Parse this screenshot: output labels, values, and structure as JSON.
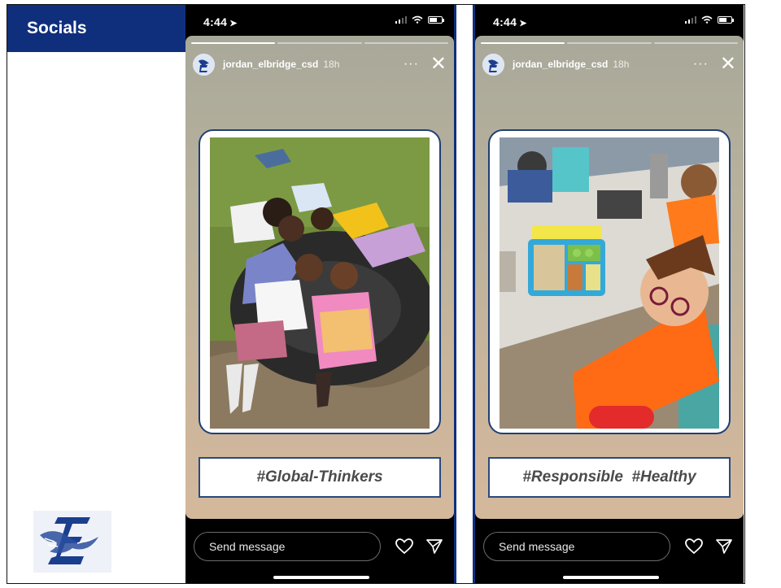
{
  "left_panel": {
    "title": "Socials"
  },
  "stories": [
    {
      "status_time": "4:44",
      "username": "jordan_elbridge_csd",
      "time_ago": "18h",
      "caption": "#Global-Thinkers",
      "message_placeholder": "Send message"
    },
    {
      "status_time": "4:44",
      "username": "jordan_elbridge_csd",
      "time_ago": "18h",
      "caption": "#Responsible  #Healthy",
      "message_placeholder": "Send message"
    }
  ],
  "icons": {
    "location": "location-arrow-icon",
    "more": "more-dots-icon",
    "close": "close-icon",
    "heart": "heart-icon",
    "send": "send-icon",
    "signal": "signal-icon",
    "wifi": "wifi-icon",
    "battery": "battery-icon"
  },
  "colors": {
    "header_bg": "#0f2f7d",
    "card_border": "#1f3f73",
    "caption_text": "#4a4a4a"
  }
}
